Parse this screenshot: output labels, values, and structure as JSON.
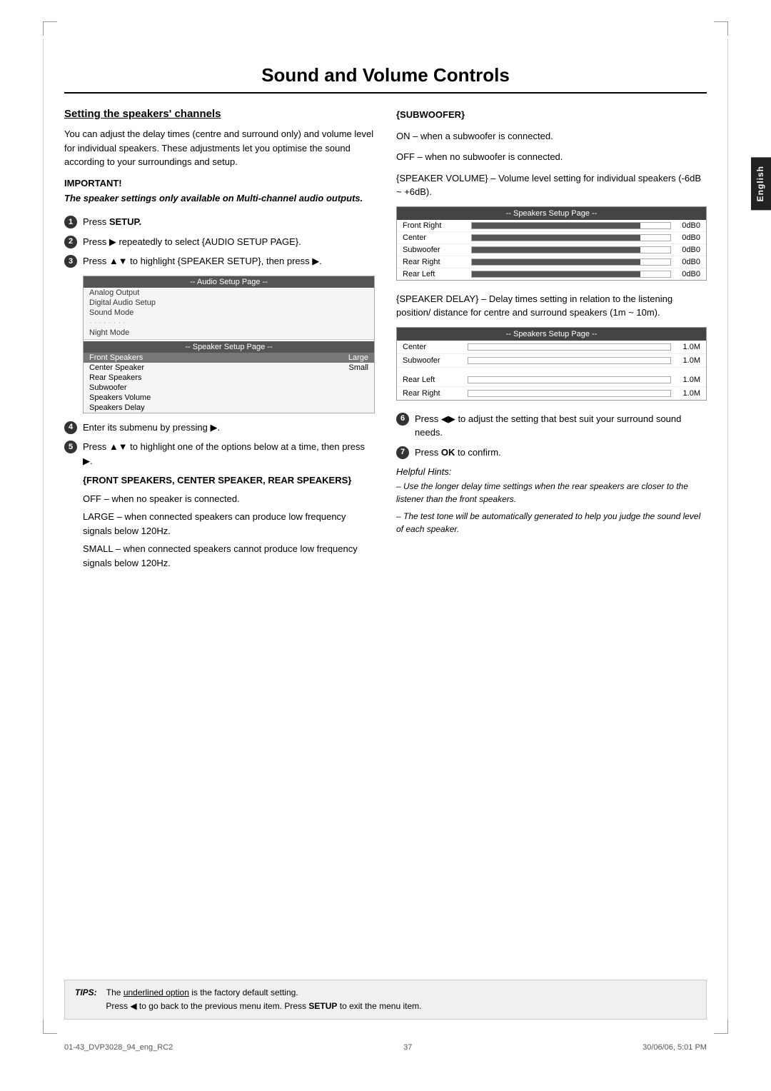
{
  "page": {
    "title": "Sound and Volume Controls",
    "number": "37",
    "footer_left": "01-43_DVP3028_94_eng_RC2",
    "footer_center": "37",
    "footer_right": "30/06/06, 5:01 PM"
  },
  "english_tab": "English",
  "section": {
    "heading": "Setting the speakers' channels",
    "intro": "You can adjust the delay times (centre and surround only) and volume level for individual speakers. These adjustments let you optimise the sound according to your surroundings and setup.",
    "important_label": "IMPORTANT!",
    "important_text": "The speaker settings only available on Multi-channel audio outputs."
  },
  "steps": {
    "step1": "Press SETUP.",
    "step2": "Press ▶ repeatedly to select {AUDIO SETUP PAGE}.",
    "step3": "Press ▲▼ to highlight {SPEAKER SETUP}, then press ▶.",
    "step4": "Enter its submenu by pressing ▶.",
    "step5": "Press ▲▼ to highlight one of the options below at a time, then press ▶.",
    "step6": "Press ◀▶ to adjust the setting that best suit your surround sound needs.",
    "step7": "Press OK to confirm."
  },
  "menu": {
    "audio_header": "-- Audio Setup Page --",
    "audio_items": [
      "Analog Output",
      "Digital Audio Setup",
      "Sound Mode",
      "· · · · · · · ·",
      "Night Mode"
    ],
    "speaker_header": "-- Speaker Setup Page --",
    "speaker_items": [
      {
        "label": "Front Speakers",
        "value": "Large",
        "highlighted": true
      },
      {
        "label": "Center Speaker",
        "value": "Small"
      },
      {
        "label": "Rear Speakers",
        "value": ""
      },
      {
        "label": "Subwoofer",
        "value": ""
      },
      {
        "label": "Speakers Volume",
        "value": ""
      },
      {
        "label": "Speakers Delay",
        "value": ""
      }
    ]
  },
  "front_rear_text": {
    "heading": "{FRONT SPEAKERS, CENTER SPEAKER, REAR SPEAKERS}",
    "off": "OFF – when no speaker is connected.",
    "large": "LARGE – when connected speakers can produce low frequency signals below 120Hz.",
    "small": "SMALL – when connected speakers cannot produce low frequency signals below 120Hz."
  },
  "subwoofer_text": {
    "heading": "{SUBWOOFER}",
    "on": "ON – when a subwoofer is connected.",
    "off": "OFF – when no subwoofer is connected."
  },
  "speaker_volume_text": "{SPEAKER VOLUME} – Volume level setting for individual speakers (-6dB ~ +6dB).",
  "speakers_setup_table": {
    "header": "-- Speakers Setup Page --",
    "rows": [
      {
        "label": "Front Right",
        "value": "0dB0"
      },
      {
        "label": "Center",
        "value": "0dB0"
      },
      {
        "label": "Subwoofer",
        "value": "0dB0"
      },
      {
        "label": "Rear Right",
        "value": "0dB0"
      },
      {
        "label": "Rear Left",
        "value": "0dB0"
      }
    ]
  },
  "speaker_delay_text": "{SPEAKER DELAY} – Delay times setting in relation to the listening position/ distance for centre and surround speakers (1m ~ 10m).",
  "delay_setup_table": {
    "header": "-- Speakers Setup Page --",
    "rows": [
      {
        "label": "Center",
        "value": "1.0M"
      },
      {
        "label": "Subwoofer",
        "value": "1.0M"
      },
      {
        "label": "Rear Left",
        "value": "1.0M"
      },
      {
        "label": "Rear Right",
        "value": "1.0M"
      }
    ]
  },
  "helpful_hints": {
    "title": "Helpful Hints:",
    "hint1": "–  Use the longer delay time settings when the rear speakers are closer to the listener than the front speakers.",
    "hint2": "–  The test tone will be automatically generated to help you judge the sound level of each speaker."
  },
  "tips": {
    "label": "TIPS:",
    "text1": "The underlined option is the factory default setting.",
    "text2": "Press ◀ to go back to the previous menu item. Press SETUP to exit the menu item."
  }
}
